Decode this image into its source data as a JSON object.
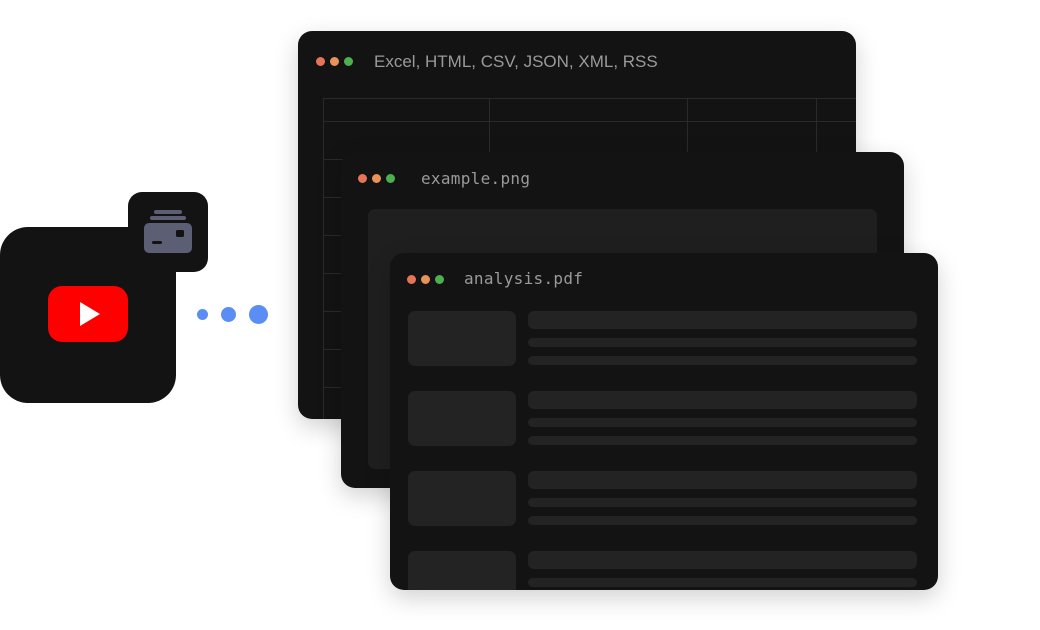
{
  "windows": {
    "data_formats": {
      "title": "Excel, HTML, CSV, JSON, XML, RSS"
    },
    "image": {
      "title": "example.png"
    },
    "pdf": {
      "title": "analysis.pdf"
    }
  },
  "icons": {
    "source_app": "youtube-icon",
    "badge": "scraper-icon"
  },
  "colors": {
    "dot_red": "#e87458",
    "dot_orange": "#e8925a",
    "dot_green": "#4caf50",
    "youtube_red": "#ff0000",
    "connector_blue": "#5b8ef5",
    "window_bg": "#131313"
  }
}
